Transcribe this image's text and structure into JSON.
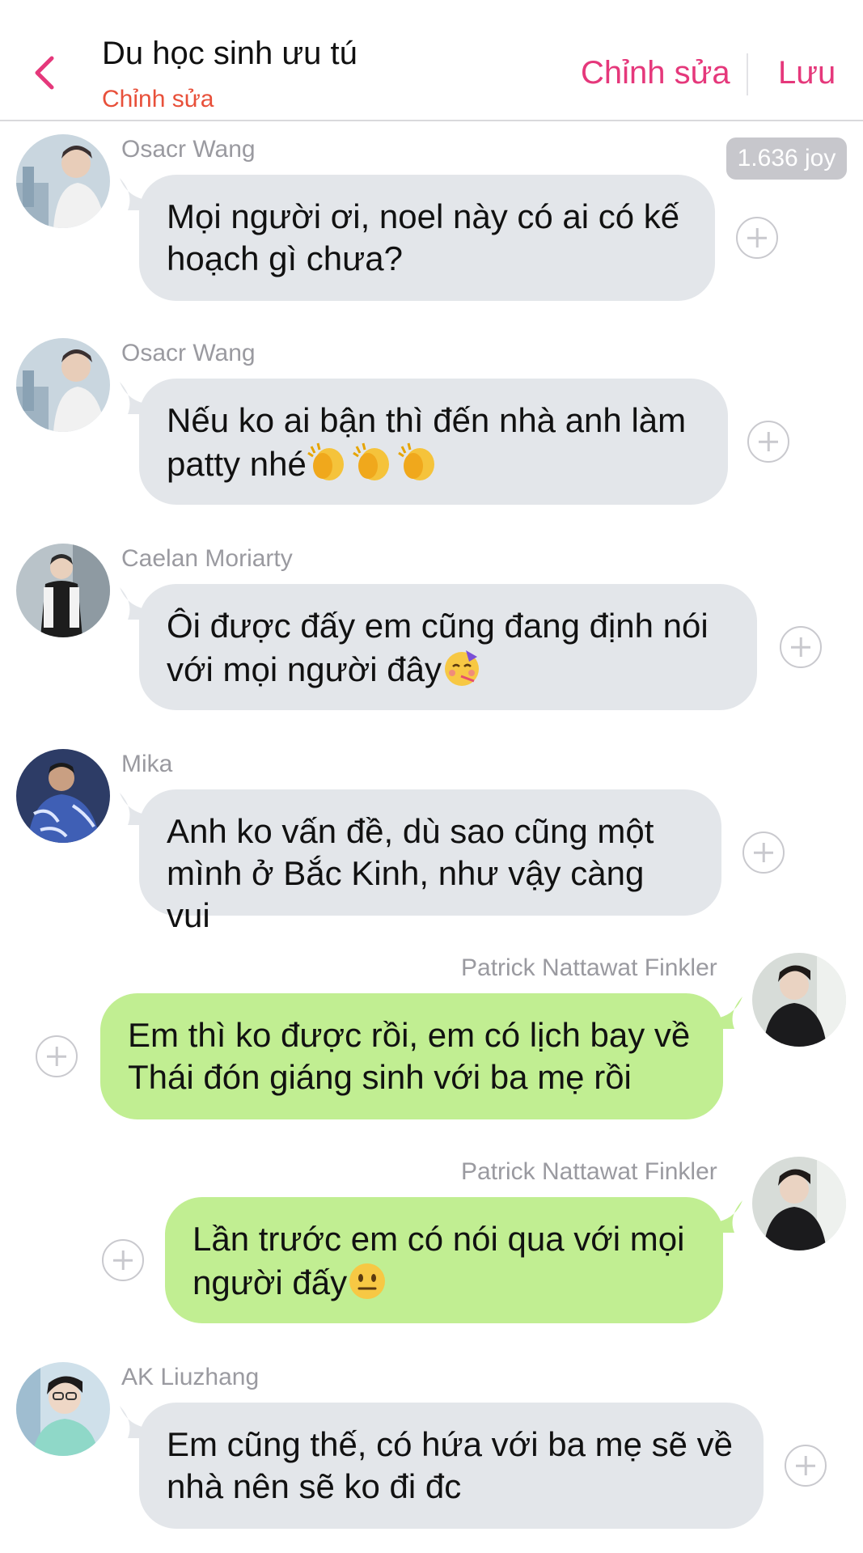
{
  "header": {
    "back_icon": "chevron-left-icon",
    "title": "Du học sinh ưu tú",
    "subtitle": "Chỉnh sửa",
    "edit_label": "Chỉnh sửa",
    "save_label": "Lưu",
    "accent_color": "#e5387b"
  },
  "joy_badge": "1.636 joy",
  "messages": [
    {
      "sender": "Osacr Wang",
      "side": "left",
      "text": "Mọi người ơi, noel này có ai có kế hoạch gì chưa?"
    },
    {
      "sender": "Osacr Wang",
      "side": "left",
      "text": "Nếu ko ai bận thì đến nhà anh làm patty nhé",
      "emoji": [
        "clapping-hands",
        "clapping-hands",
        "clapping-hands"
      ]
    },
    {
      "sender": "Caelan Moriarty",
      "side": "left",
      "text": "Ôi được đấy em cũng đang định nói với mọi người đây",
      "emoji": [
        "partying-face"
      ]
    },
    {
      "sender": "Mika",
      "side": "left",
      "text": "Anh ko vấn đề, dù sao cũng một mình ở Bắc Kinh, như vậy càng vui"
    },
    {
      "sender": "Patrick Nattawat Finkler",
      "side": "right",
      "text": "Em thì ko được rồi, em có lịch bay về Thái đón giáng sinh với ba mẹ rồi"
    },
    {
      "sender": "Patrick Nattawat Finkler",
      "side": "right",
      "text": "Lần trước em có nói qua với mọi người đấy",
      "emoji": [
        "neutral-face"
      ]
    },
    {
      "sender": "AK Liuzhang",
      "side": "left",
      "text": "Em cũng thế, có hứa với ba mẹ sẽ về nhà nên sẽ ko đi đc"
    }
  ],
  "colors": {
    "incoming_bubble": "#e3e6ea",
    "outgoing_bubble": "#c1ee92",
    "sender_name": "#9a9aa0"
  }
}
